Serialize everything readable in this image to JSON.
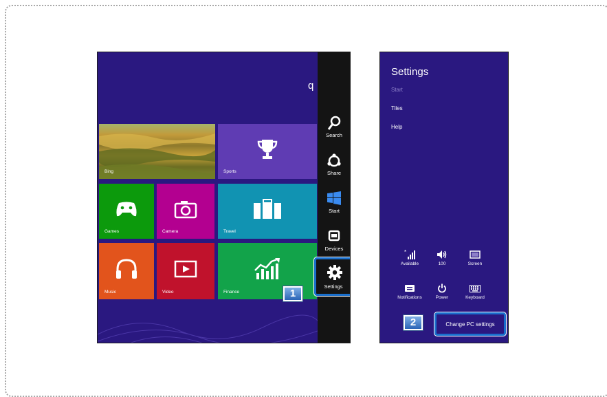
{
  "start_screen": {
    "search_letter": "q",
    "tiles": {
      "bing": "Bing",
      "sports": "Sports",
      "games": "Games",
      "camera": "Camera",
      "travel": "Travel",
      "music": "Music",
      "video": "Video",
      "finance": "Finance"
    },
    "charms": {
      "search": "Search",
      "share": "Share",
      "start": "Start",
      "devices": "Devices",
      "settings": "Settings"
    }
  },
  "steps": {
    "one": "1",
    "two": "2"
  },
  "settings_pane": {
    "title": "Settings",
    "items": [
      "Start",
      "Tiles",
      "Help"
    ],
    "quick_settings": {
      "network": "Available",
      "volume": "100",
      "screen": "Screen",
      "notifications": "Notifications",
      "power": "Power",
      "keyboard": "Keyboard"
    },
    "change_pc_settings": "Change PC settings"
  },
  "colors": {
    "background": "#2a1880",
    "charms_bar": "#141414",
    "highlight": "#1a6fcc",
    "sports": "#5f3cb3",
    "games": "#0c9a0c",
    "camera": "#b30090",
    "travel": "#1193b2",
    "music": "#e2541c",
    "video": "#c0122c",
    "finance": "#12a34a"
  }
}
